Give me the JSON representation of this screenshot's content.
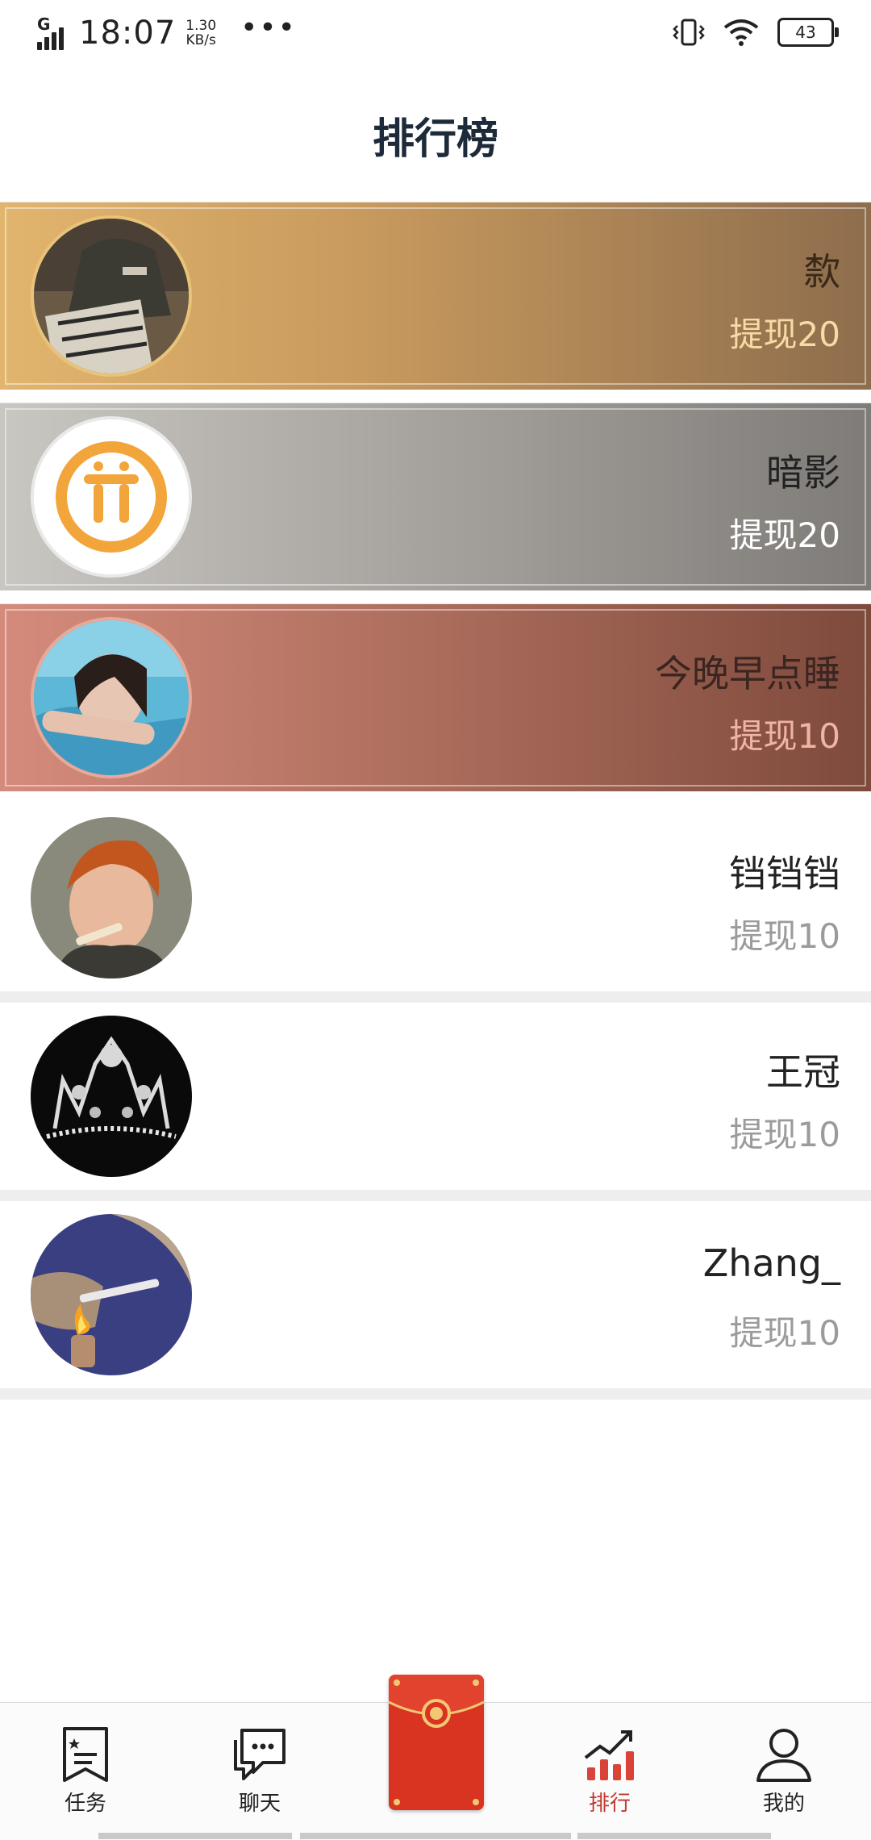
{
  "status": {
    "network": "G",
    "time": "18:07",
    "speed_value": "1.30",
    "speed_unit": "KB/s",
    "more": "•••",
    "battery": "43"
  },
  "header": {
    "title": "排行榜"
  },
  "ranking": [
    {
      "name": "歀",
      "amount": "提现20"
    },
    {
      "name": "暗影",
      "amount": "提现20"
    },
    {
      "name": "今晚早点睡",
      "amount": "提现10"
    },
    {
      "name": "铛铛铛",
      "amount": "提现10"
    },
    {
      "name": "王冠",
      "amount": "提现10"
    },
    {
      "name": "Zhang_",
      "amount": "提现10"
    }
  ],
  "tabs": {
    "task": "任务",
    "chat": "聊天",
    "rank": "排行",
    "mine": "我的"
  },
  "colors": {
    "accent_red": "#d93322",
    "active_tab": "#c1382e",
    "gold": "#e2b56e"
  }
}
